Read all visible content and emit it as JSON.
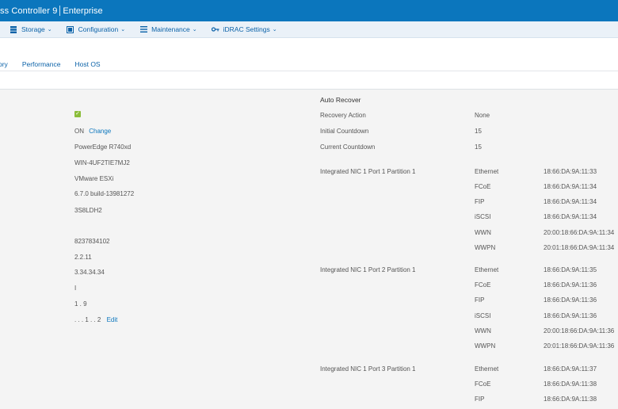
{
  "titlebar": {
    "app": "ss Controller 9",
    "edition": "Enterprise"
  },
  "menu": [
    {
      "label": "Storage",
      "icon": "storage-icon"
    },
    {
      "label": "Configuration",
      "icon": "configuration-icon"
    },
    {
      "label": "Maintenance",
      "icon": "maintenance-icon"
    },
    {
      "label": "iDRAC Settings",
      "icon": "key-icon"
    }
  ],
  "tabs": [
    "ory",
    "Performance",
    "Host OS"
  ],
  "system": {
    "check_value": "✓",
    "power": "ON",
    "power_change": "Change",
    "model": "PowerEdge R740xd",
    "host_name": "WIN-4UF2TIE7MJ2",
    "os": "VMware ESXi",
    "os_version": "6.7.0 build-13981272",
    "service_tag": "3S8LDH2",
    "express_code": "8237834102",
    "bios": "2.2.11",
    "idrac_fw": "3.34.34.34",
    "row_i": "I",
    "row_19": "1 . 9",
    "location": ". . . 1 . . 2",
    "location_edit": "Edit"
  },
  "auto_recover": {
    "title": "Auto Recover",
    "rows": [
      {
        "label": "Recovery Action",
        "value": "None"
      },
      {
        "label": "Initial Countdown",
        "value": "15"
      },
      {
        "label": "Current Countdown",
        "value": "15"
      }
    ]
  },
  "nics": [
    {
      "name": "Integrated NIC 1 Port 1 Partition 1",
      "entries": [
        {
          "type": "Ethernet",
          "addr": "18:66:DA:9A:11:33"
        },
        {
          "type": "FCoE",
          "addr": "18:66:DA:9A:11:34"
        },
        {
          "type": "FIP",
          "addr": "18:66:DA:9A:11:34"
        },
        {
          "type": "iSCSI",
          "addr": "18:66:DA:9A:11:34"
        },
        {
          "type": "WWN",
          "addr": "20:00:18:66:DA:9A:11:34"
        },
        {
          "type": "WWPN",
          "addr": "20:01:18:66:DA:9A:11:34"
        }
      ]
    },
    {
      "name": "Integrated NIC 1 Port 2 Partition 1",
      "entries": [
        {
          "type": "Ethernet",
          "addr": "18:66:DA:9A:11:35"
        },
        {
          "type": "FCoE",
          "addr": "18:66:DA:9A:11:36"
        },
        {
          "type": "FIP",
          "addr": "18:66:DA:9A:11:36"
        },
        {
          "type": "iSCSI",
          "addr": "18:66:DA:9A:11:36"
        },
        {
          "type": "WWN",
          "addr": "20:00:18:66:DA:9A:11:36"
        },
        {
          "type": "WWPN",
          "addr": "20:01:18:66:DA:9A:11:36"
        }
      ]
    },
    {
      "name": "Integrated NIC 1 Port 3 Partition 1",
      "entries": [
        {
          "type": "Ethernet",
          "addr": "18:66:DA:9A:11:37"
        },
        {
          "type": "FCoE",
          "addr": "18:66:DA:9A:11:38"
        },
        {
          "type": "FIP",
          "addr": "18:66:DA:9A:11:38"
        }
      ]
    }
  ]
}
